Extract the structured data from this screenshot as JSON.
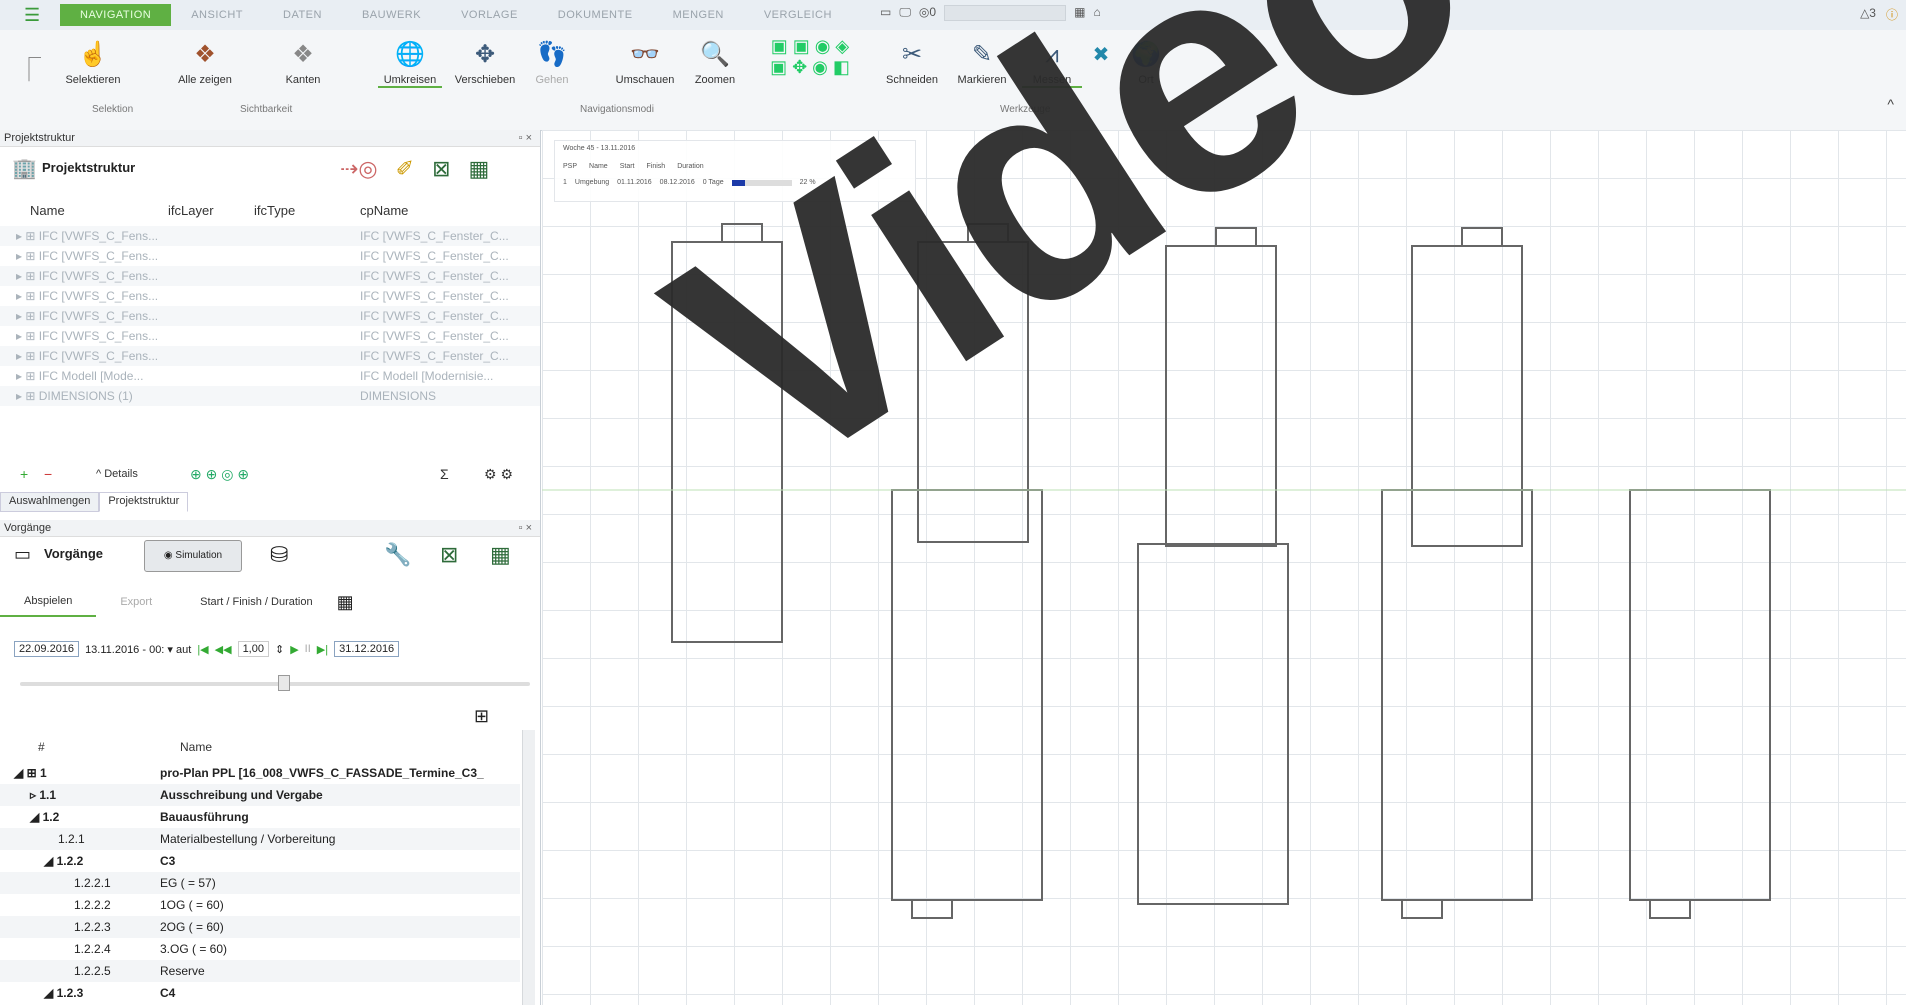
{
  "topbar": {
    "tabs": [
      "NAVIGATION",
      "ANSICHT",
      "DATEN",
      "BAUWERK",
      "VORLAGE",
      "DOKUMENTE",
      "MENGEN",
      "VERGLEICH"
    ],
    "active_tab": 0,
    "counter": "0",
    "warnings": "3"
  },
  "ribbon": {
    "buttons": [
      {
        "label": "Selektieren",
        "icon": "select-icon"
      },
      {
        "label": "Alle zeigen",
        "icon": "show-all-icon"
      },
      {
        "label": "Kanten",
        "icon": "edges-icon"
      },
      {
        "label": "Umkreisen",
        "icon": "orbit-icon"
      },
      {
        "label": "Verschieben",
        "icon": "pan-icon"
      },
      {
        "label": "Gehen",
        "icon": "walk-icon"
      },
      {
        "label": "Umschauen",
        "icon": "look-around-icon"
      },
      {
        "label": "Zoomen",
        "icon": "zoom-icon"
      },
      {
        "label": "Schneiden",
        "icon": "cut-icon"
      },
      {
        "label": "Markieren",
        "icon": "markup-icon"
      },
      {
        "label": "Messen",
        "icon": "measure-icon"
      },
      {
        "label": "Ort",
        "icon": "location-icon"
      }
    ],
    "groups": [
      "Selektion",
      "Sichtbarkeit",
      "Navigationsmodi",
      "Werkzeuge"
    ]
  },
  "project_structure": {
    "panel_title": "Projektstruktur",
    "title": "Projektstruktur",
    "columns": [
      "Name",
      "ifcLayer",
      "ifcType",
      "cpName"
    ],
    "rows": [
      {
        "name": "IFC [VWFS_C_Fens...",
        "cp": "IFC [VWFS_C_Fenster_C..."
      },
      {
        "name": "IFC [VWFS_C_Fens...",
        "cp": "IFC [VWFS_C_Fenster_C..."
      },
      {
        "name": "IFC [VWFS_C_Fens...",
        "cp": "IFC [VWFS_C_Fenster_C..."
      },
      {
        "name": "IFC [VWFS_C_Fens...",
        "cp": "IFC [VWFS_C_Fenster_C..."
      },
      {
        "name": "IFC [VWFS_C_Fens...",
        "cp": "IFC [VWFS_C_Fenster_C..."
      },
      {
        "name": "IFC [VWFS_C_Fens...",
        "cp": "IFC [VWFS_C_Fenster_C..."
      },
      {
        "name": "IFC [VWFS_C_Fens...",
        "cp": "IFC [VWFS_C_Fenster_C..."
      },
      {
        "name": "IFC Modell [Mode...",
        "cp": "IFC Modell [Modernisie..."
      },
      {
        "name": "DIMENSIONS (1)",
        "cp": "DIMENSIONS"
      }
    ],
    "details_label": "Details",
    "sum_symbol": "Σ",
    "tabs": [
      "Auswahlmengen",
      "Projektstruktur"
    ]
  },
  "vorgaenge": {
    "panel_title": "Vorgänge",
    "title": "Vorgänge",
    "simulation_label": "Simulation",
    "tabs": [
      "Abspielen",
      "Export",
      "Start / Finish / Duration"
    ],
    "start_date": "22.09.2016",
    "current_date": "13.11.2016 - 00:",
    "unit": "aut",
    "speed": "1,00",
    "end_date": "31.12.2016",
    "tree_columns": [
      "#",
      "Name"
    ],
    "tree": [
      {
        "num": "1",
        "name": "pro-Plan PPL [16_008_VWFS_C_FASSADE_Termine_C3_",
        "bold": true
      },
      {
        "num": "1.1",
        "name": "Ausschreibung und Vergabe",
        "bold": true
      },
      {
        "num": "1.2",
        "name": "Bauausführung",
        "bold": true
      },
      {
        "num": "1.2.1",
        "name": "Materialbestellung / Vorbereitung",
        "bold": false
      },
      {
        "num": "1.2.2",
        "name": "C3",
        "bold": true
      },
      {
        "num": "1.2.2.1",
        "name": "EG ( = 57)",
        "bold": false
      },
      {
        "num": "1.2.2.2",
        "name": "1OG ( = 60)",
        "bold": false
      },
      {
        "num": "1.2.2.3",
        "name": "2OG ( = 60)",
        "bold": false
      },
      {
        "num": "1.2.2.4",
        "name": "3.OG ( = 60)",
        "bold": false
      },
      {
        "num": "1.2.2.5",
        "name": "Reserve",
        "bold": false
      },
      {
        "num": "1.2.3",
        "name": "C4",
        "bold": true
      }
    ]
  },
  "viewport": {
    "overlay_title": "Woche 45 - 13.11.2016",
    "overlay_headers": [
      "PSP",
      "Name",
      "Start",
      "Finish",
      "Duration"
    ],
    "overlay_row": {
      "psp": "1",
      "name": "Umgebung",
      "start": "01.11.2016",
      "finish": "08.12.2016",
      "duration": "0 Tage",
      "percent": "22 %",
      "progress": 0.22
    },
    "watermark": "Video"
  }
}
